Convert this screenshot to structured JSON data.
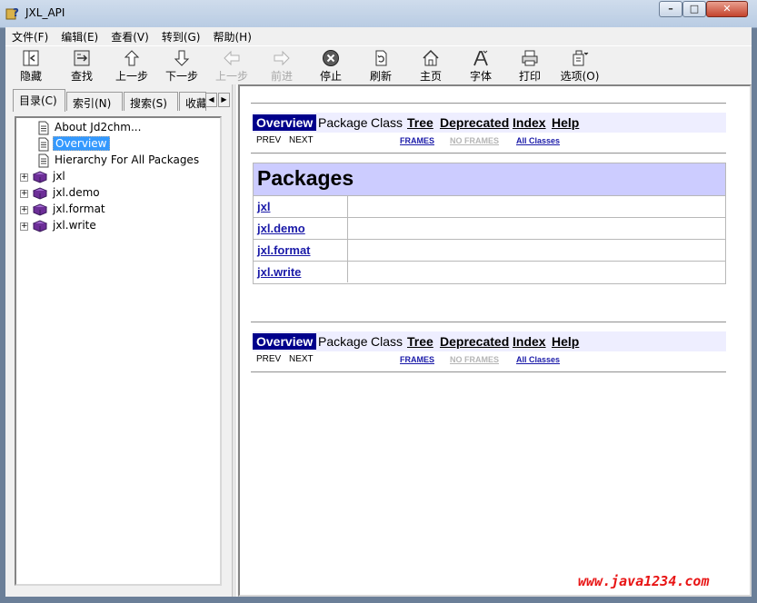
{
  "window": {
    "title": "JXL_API",
    "buttons": {
      "minimize": "–",
      "maximize": "□",
      "close": "✕"
    }
  },
  "menu": [
    "文件(F)",
    "编辑(E)",
    "查看(V)",
    "转到(G)",
    "帮助(H)"
  ],
  "toolbar": [
    {
      "label": "隐藏",
      "icon": "hide-pane-icon",
      "enabled": true
    },
    {
      "label": "查找",
      "icon": "locate-icon",
      "enabled": true
    },
    {
      "label": "上一步",
      "icon": "arrow-up-icon",
      "enabled": true
    },
    {
      "label": "下一步",
      "icon": "arrow-down-icon",
      "enabled": true
    },
    {
      "label": "上一步",
      "icon": "arrow-left-icon",
      "enabled": false
    },
    {
      "label": "前进",
      "icon": "arrow-right-icon",
      "enabled": false
    },
    {
      "label": "停止",
      "icon": "stop-icon",
      "enabled": true
    },
    {
      "label": "刷新",
      "icon": "refresh-icon",
      "enabled": true
    },
    {
      "label": "主页",
      "icon": "home-icon",
      "enabled": true
    },
    {
      "label": "字体",
      "icon": "font-icon",
      "enabled": true
    },
    {
      "label": "打印",
      "icon": "print-icon",
      "enabled": true
    },
    {
      "label": "选项(O)",
      "icon": "options-icon",
      "enabled": true
    }
  ],
  "nav_tabs": [
    "目录(C)",
    "索引(N)",
    "搜索(S)",
    "收藏"
  ],
  "tree": [
    {
      "label": "About Jd2chm...",
      "type": "page",
      "selected": false
    },
    {
      "label": "Overview",
      "type": "page",
      "selected": true
    },
    {
      "label": "Hierarchy For All Packages",
      "type": "page",
      "selected": false
    },
    {
      "label": "jxl",
      "type": "book",
      "selected": false
    },
    {
      "label": "jxl.demo",
      "type": "book",
      "selected": false
    },
    {
      "label": "jxl.format",
      "type": "book",
      "selected": false
    },
    {
      "label": "jxl.write",
      "type": "book",
      "selected": false
    }
  ],
  "doc": {
    "navbar": {
      "current": "Overview",
      "plain": [
        "Package",
        "Class"
      ],
      "links": [
        "Tree",
        "Deprecated",
        "Index",
        "Help"
      ]
    },
    "subnav": {
      "prev": "PREV",
      "next": "NEXT",
      "frames": "FRAMES",
      "no_frames": "NO FRAMES",
      "all_classes": "All Classes"
    },
    "packages_heading": "Packages",
    "packages": [
      "jxl",
      "jxl.demo",
      "jxl.format",
      "jxl.write"
    ]
  },
  "watermark": "www.java1234.com",
  "colors": {
    "nav_current_bg": "#00008b",
    "nav_bar_bg": "#eeeeff",
    "table_head_bg": "#ccccff",
    "link": "#1a1aa8",
    "selection": "#3399ff",
    "watermark": "#e81414"
  }
}
